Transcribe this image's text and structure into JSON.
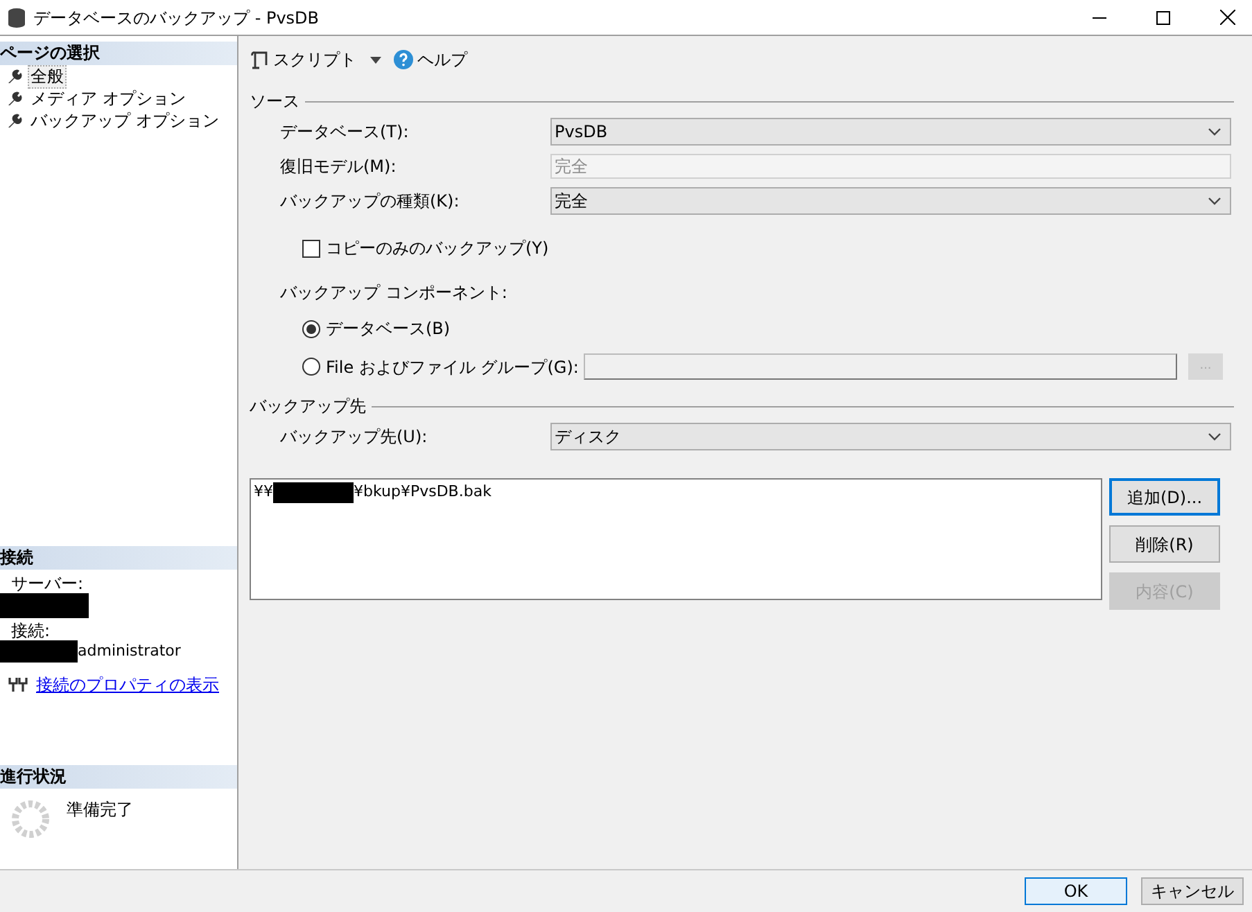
{
  "window": {
    "title": "データベースのバックアップ - PvsDB"
  },
  "sidebar": {
    "page_select": {
      "header": "ページの選択",
      "items": [
        {
          "label": "全般",
          "selected": true
        },
        {
          "label": "メディア オプション",
          "selected": false
        },
        {
          "label": "バックアップ オプション",
          "selected": false
        }
      ]
    },
    "connection": {
      "header": "接続",
      "server_label": "サーバー:",
      "connection_label": "接続:",
      "connection_value": "administrator",
      "link": "接続のプロパティの表示"
    },
    "progress": {
      "header": "進行状況",
      "status": "準備完了"
    }
  },
  "toolbar": {
    "script": "スクリプト",
    "help": "ヘルプ"
  },
  "source": {
    "header": "ソース",
    "rows": [
      {
        "label": "データベース(T):",
        "value": "PvsDB",
        "disabled": false
      },
      {
        "label": "復旧モデル(M):",
        "value": "完全",
        "disabled": true
      },
      {
        "label": "バックアップの種類(K):",
        "value": "完全",
        "disabled": false
      }
    ],
    "copy_only": {
      "label": "コピーのみのバックアップ(Y)",
      "checked": false
    },
    "components_label": "バックアップ コンポーネント:",
    "components": [
      {
        "label": "データベース(B)",
        "selected": true
      },
      {
        "label": "File およびファイル グループ(G):",
        "selected": false
      }
    ],
    "browse": "..."
  },
  "destination": {
    "header": "バックアップ先",
    "label": "バックアップ先(U):",
    "value": "ディスク",
    "paths": [
      {
        "prefix": "¥¥",
        "suffix": "¥bkup¥PvsDB.bak"
      }
    ],
    "buttons": [
      {
        "label": "追加(D)...",
        "disabled": false,
        "focused": true
      },
      {
        "label": "削除(R)",
        "disabled": false,
        "focused": false
      },
      {
        "label": "内容(C)",
        "disabled": true,
        "focused": false
      }
    ]
  },
  "footer": {
    "buttons": [
      {
        "label": "OK",
        "default": true
      },
      {
        "label": "キャンセル",
        "default": false
      }
    ]
  }
}
